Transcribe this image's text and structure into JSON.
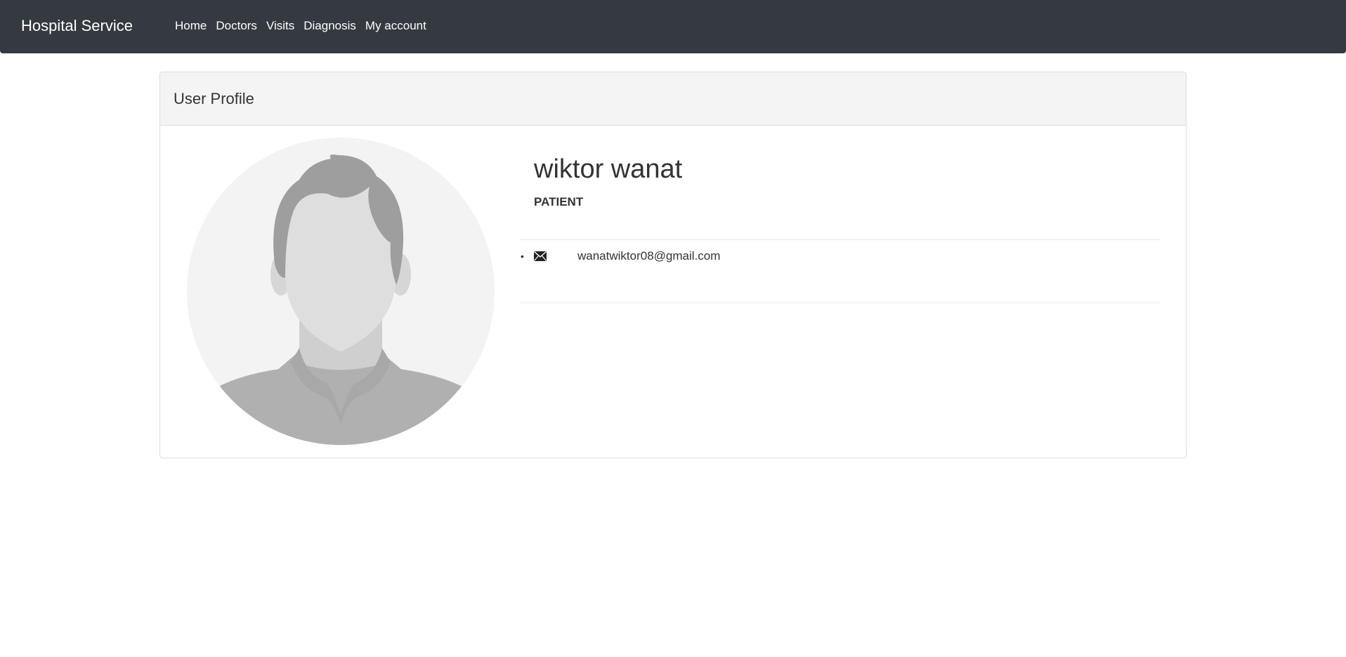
{
  "navbar": {
    "brand": "Hospital Service",
    "links": [
      {
        "label": "Home"
      },
      {
        "label": "Doctors"
      },
      {
        "label": "Visits"
      },
      {
        "label": "Diagnosis"
      },
      {
        "label": "My account"
      }
    ],
    "background_color": "#343a40"
  },
  "panel": {
    "title": "User Profile",
    "heading_color": "#f4f4f4"
  },
  "profile": {
    "avatar_icon": "default-user-avatar",
    "name": "wiktor wanat",
    "role": "PATIENT",
    "contacts": [
      {
        "icon": "envelope-icon",
        "value": "wanatwiktor08@gmail.com"
      }
    ]
  }
}
